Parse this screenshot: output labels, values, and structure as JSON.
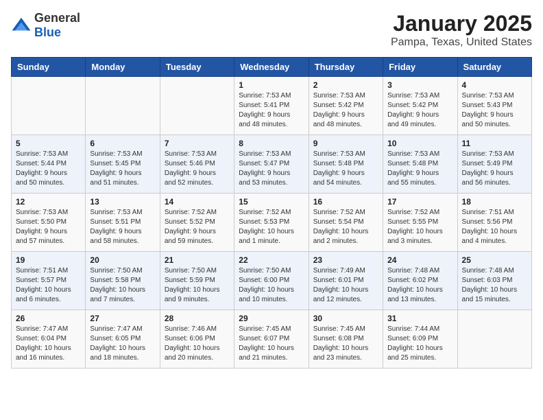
{
  "header": {
    "logo_general": "General",
    "logo_blue": "Blue",
    "title": "January 2025",
    "subtitle": "Pampa, Texas, United States"
  },
  "days_of_week": [
    "Sunday",
    "Monday",
    "Tuesday",
    "Wednesday",
    "Thursday",
    "Friday",
    "Saturday"
  ],
  "weeks": [
    [
      {
        "day": "",
        "info": ""
      },
      {
        "day": "",
        "info": ""
      },
      {
        "day": "",
        "info": ""
      },
      {
        "day": "1",
        "info": "Sunrise: 7:53 AM\nSunset: 5:41 PM\nDaylight: 9 hours\nand 48 minutes."
      },
      {
        "day": "2",
        "info": "Sunrise: 7:53 AM\nSunset: 5:42 PM\nDaylight: 9 hours\nand 48 minutes."
      },
      {
        "day": "3",
        "info": "Sunrise: 7:53 AM\nSunset: 5:42 PM\nDaylight: 9 hours\nand 49 minutes."
      },
      {
        "day": "4",
        "info": "Sunrise: 7:53 AM\nSunset: 5:43 PM\nDaylight: 9 hours\nand 50 minutes."
      }
    ],
    [
      {
        "day": "5",
        "info": "Sunrise: 7:53 AM\nSunset: 5:44 PM\nDaylight: 9 hours\nand 50 minutes."
      },
      {
        "day": "6",
        "info": "Sunrise: 7:53 AM\nSunset: 5:45 PM\nDaylight: 9 hours\nand 51 minutes."
      },
      {
        "day": "7",
        "info": "Sunrise: 7:53 AM\nSunset: 5:46 PM\nDaylight: 9 hours\nand 52 minutes."
      },
      {
        "day": "8",
        "info": "Sunrise: 7:53 AM\nSunset: 5:47 PM\nDaylight: 9 hours\nand 53 minutes."
      },
      {
        "day": "9",
        "info": "Sunrise: 7:53 AM\nSunset: 5:48 PM\nDaylight: 9 hours\nand 54 minutes."
      },
      {
        "day": "10",
        "info": "Sunrise: 7:53 AM\nSunset: 5:48 PM\nDaylight: 9 hours\nand 55 minutes."
      },
      {
        "day": "11",
        "info": "Sunrise: 7:53 AM\nSunset: 5:49 PM\nDaylight: 9 hours\nand 56 minutes."
      }
    ],
    [
      {
        "day": "12",
        "info": "Sunrise: 7:53 AM\nSunset: 5:50 PM\nDaylight: 9 hours\nand 57 minutes."
      },
      {
        "day": "13",
        "info": "Sunrise: 7:53 AM\nSunset: 5:51 PM\nDaylight: 9 hours\nand 58 minutes."
      },
      {
        "day": "14",
        "info": "Sunrise: 7:52 AM\nSunset: 5:52 PM\nDaylight: 9 hours\nand 59 minutes."
      },
      {
        "day": "15",
        "info": "Sunrise: 7:52 AM\nSunset: 5:53 PM\nDaylight: 10 hours\nand 1 minute."
      },
      {
        "day": "16",
        "info": "Sunrise: 7:52 AM\nSunset: 5:54 PM\nDaylight: 10 hours\nand 2 minutes."
      },
      {
        "day": "17",
        "info": "Sunrise: 7:52 AM\nSunset: 5:55 PM\nDaylight: 10 hours\nand 3 minutes."
      },
      {
        "day": "18",
        "info": "Sunrise: 7:51 AM\nSunset: 5:56 PM\nDaylight: 10 hours\nand 4 minutes."
      }
    ],
    [
      {
        "day": "19",
        "info": "Sunrise: 7:51 AM\nSunset: 5:57 PM\nDaylight: 10 hours\nand 6 minutes."
      },
      {
        "day": "20",
        "info": "Sunrise: 7:50 AM\nSunset: 5:58 PM\nDaylight: 10 hours\nand 7 minutes."
      },
      {
        "day": "21",
        "info": "Sunrise: 7:50 AM\nSunset: 5:59 PM\nDaylight: 10 hours\nand 9 minutes."
      },
      {
        "day": "22",
        "info": "Sunrise: 7:50 AM\nSunset: 6:00 PM\nDaylight: 10 hours\nand 10 minutes."
      },
      {
        "day": "23",
        "info": "Sunrise: 7:49 AM\nSunset: 6:01 PM\nDaylight: 10 hours\nand 12 minutes."
      },
      {
        "day": "24",
        "info": "Sunrise: 7:48 AM\nSunset: 6:02 PM\nDaylight: 10 hours\nand 13 minutes."
      },
      {
        "day": "25",
        "info": "Sunrise: 7:48 AM\nSunset: 6:03 PM\nDaylight: 10 hours\nand 15 minutes."
      }
    ],
    [
      {
        "day": "26",
        "info": "Sunrise: 7:47 AM\nSunset: 6:04 PM\nDaylight: 10 hours\nand 16 minutes."
      },
      {
        "day": "27",
        "info": "Sunrise: 7:47 AM\nSunset: 6:05 PM\nDaylight: 10 hours\nand 18 minutes."
      },
      {
        "day": "28",
        "info": "Sunrise: 7:46 AM\nSunset: 6:06 PM\nDaylight: 10 hours\nand 20 minutes."
      },
      {
        "day": "29",
        "info": "Sunrise: 7:45 AM\nSunset: 6:07 PM\nDaylight: 10 hours\nand 21 minutes."
      },
      {
        "day": "30",
        "info": "Sunrise: 7:45 AM\nSunset: 6:08 PM\nDaylight: 10 hours\nand 23 minutes."
      },
      {
        "day": "31",
        "info": "Sunrise: 7:44 AM\nSunset: 6:09 PM\nDaylight: 10 hours\nand 25 minutes."
      },
      {
        "day": "",
        "info": ""
      }
    ]
  ]
}
